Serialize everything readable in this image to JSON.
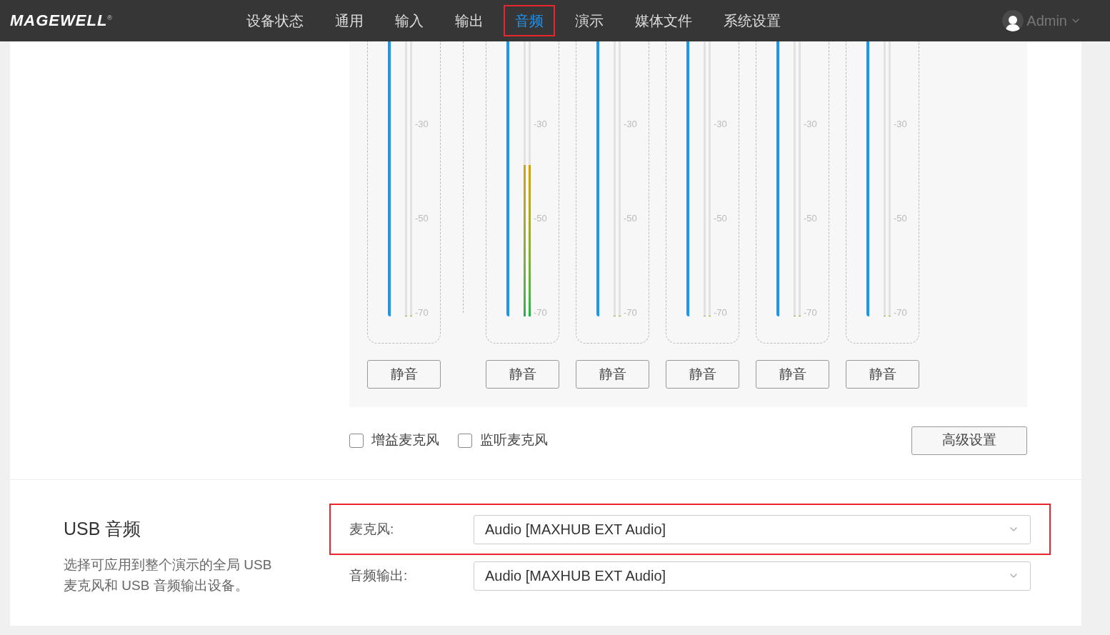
{
  "header": {
    "logo": "MAGEWELL",
    "logo_mark": "®",
    "nav": [
      {
        "label": "设备状态",
        "selected": false,
        "highlighted": false
      },
      {
        "label": "通用",
        "selected": false,
        "highlighted": false
      },
      {
        "label": "输入",
        "selected": false,
        "highlighted": false
      },
      {
        "label": "输出",
        "selected": false,
        "highlighted": false
      },
      {
        "label": "音频",
        "selected": true,
        "highlighted": true
      },
      {
        "label": "演示",
        "selected": false,
        "highlighted": false
      },
      {
        "label": "媒体文件",
        "selected": false,
        "highlighted": false
      },
      {
        "label": "系统设置",
        "selected": false,
        "highlighted": false
      }
    ],
    "user": "Admin"
  },
  "mixer": {
    "channels": [
      {
        "volume": {
          "level": 1
        },
        "meter_left": {
          "level": 0
        },
        "meter_right": {
          "level": 0
        },
        "scale": [
          "-30",
          "-50",
          "-70"
        ],
        "mute_button": "静音"
      },
      {
        "volume": {
          "level": 1
        },
        "meter_left": {
          "level": 0.55
        },
        "meter_right": {
          "level": 0.55
        },
        "scale": [
          "-30",
          "-50",
          "-70"
        ],
        "mute_button": "静音"
      },
      {
        "volume": {
          "level": 1
        },
        "meter_left": {
          "level": 0
        },
        "meter_right": {
          "level": 0
        },
        "scale": [
          "-30",
          "-50",
          "-70"
        ],
        "mute_button": "静音"
      },
      {
        "volume": {
          "level": 1
        },
        "meter_left": {
          "level": 0
        },
        "meter_right": {
          "level": 0
        },
        "scale": [
          "-30",
          "-50",
          "-70"
        ],
        "mute_button": "静音"
      },
      {
        "volume": {
          "level": 1
        },
        "meter_left": {
          "level": 0
        },
        "meter_right": {
          "level": 0
        },
        "scale": [
          "-30",
          "-50",
          "-70"
        ],
        "mute_button": "静音"
      },
      {
        "volume": {
          "level": 1
        },
        "meter_left": {
          "level": 0
        },
        "meter_right": {
          "level": 0
        },
        "scale": [
          "-30",
          "-50",
          "-70"
        ],
        "mute_button": "静音"
      }
    ],
    "options": [
      {
        "label": "增益麦克风",
        "checked": false
      },
      {
        "label": "监听麦克风",
        "checked": false
      }
    ],
    "advanced_button": "高级设置"
  },
  "usb_audio": {
    "title": "USB 音频",
    "description": "选择可应用到整个演示的全局 USB 麦克风和 USB 音频输出设备。",
    "rows": [
      {
        "label": "麦克风:",
        "value": "Audio [MAXHUB EXT Audio]",
        "highlighted": true
      },
      {
        "label": "音频输出:",
        "value": "Audio [MAXHUB EXT Audio]",
        "highlighted": false
      }
    ]
  }
}
